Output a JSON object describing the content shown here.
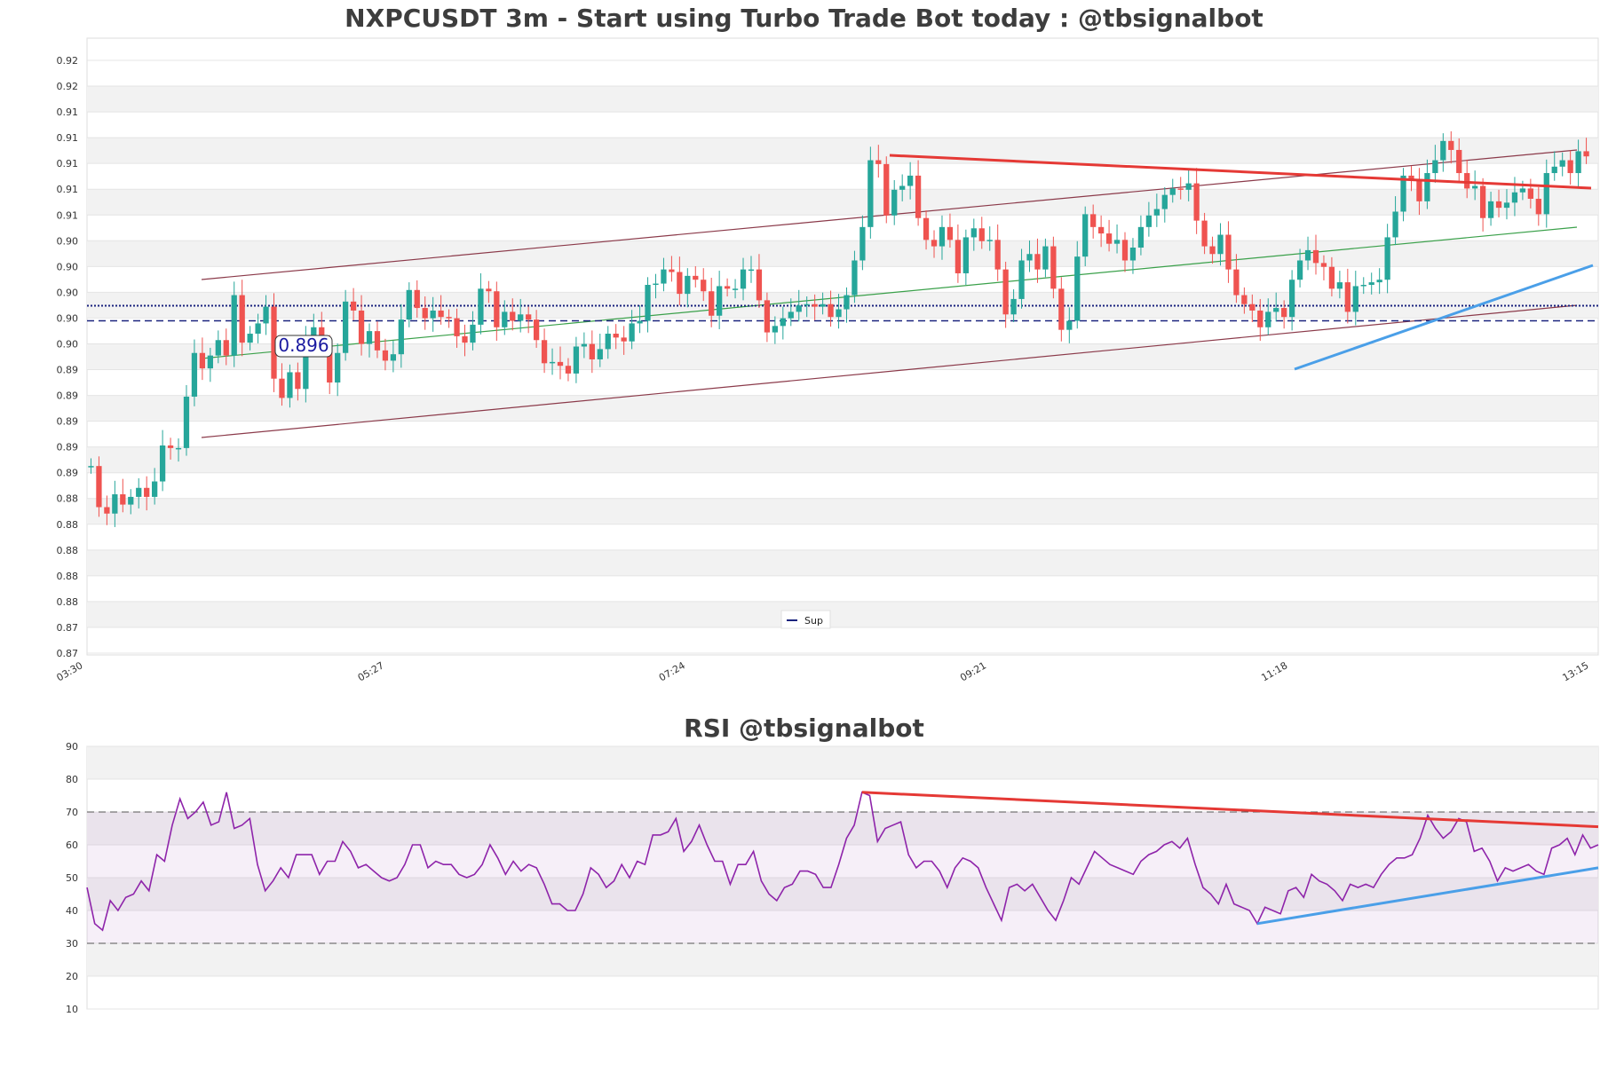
{
  "main_title": "NXPCUSDT 3m - Start using Turbo Trade Bot today : @tbsignalbot",
  "rsi_title": "RSI @tbsignalbot",
  "price_label": "0.896",
  "legend_label": "Sup",
  "colors": {
    "up": "#26a69a",
    "down": "#ef5350",
    "support": "#1a237e",
    "resistance_trend": "#e53935",
    "support_trend": "#4a9fe8",
    "channel": "#8b3a4a",
    "midline": "#3aa04a",
    "rsi_line": "#8e24aa"
  },
  "chart_data": [
    {
      "type": "candlestick",
      "title": "NXPCUSDT 3m - Start using Turbo Trade Bot today : @tbsignalbot",
      "x_tick_labels": [
        "03:30",
        "05:27",
        "07:24",
        "09:21",
        "11:18",
        "13:15"
      ],
      "y_tick_labels": [
        "0.92",
        "0.92",
        "0.91",
        "0.91",
        "0.91",
        "0.91",
        "0.91",
        "0.90",
        "0.90",
        "0.90",
        "0.90",
        "0.90",
        "0.89",
        "0.89",
        "0.89",
        "0.89",
        "0.89",
        "0.88",
        "0.88",
        "0.88",
        "0.88",
        "0.88",
        "0.87",
        "0.87"
      ],
      "ylim": [
        0.8715,
        0.9195
      ],
      "support_level": 0.8975,
      "support_label": "0.896",
      "legend": [
        "Sup"
      ],
      "legend_position": "bottom-center",
      "candles_start_close": 0.8862,
      "candle_closes": [
        0.8862,
        0.883,
        0.8825,
        0.884,
        0.8832,
        0.8838,
        0.8845,
        0.8838,
        0.885,
        0.8878,
        0.8876,
        0.8876,
        0.8916,
        0.895,
        0.8938,
        0.8948,
        0.896,
        0.8948,
        0.8995,
        0.8958,
        0.8965,
        0.8973,
        0.8986,
        0.893,
        0.8915,
        0.8935,
        0.8922,
        0.8962,
        0.897,
        0.8958,
        0.8927,
        0.895,
        0.899,
        0.8983,
        0.8957,
        0.8967,
        0.8952,
        0.8944,
        0.8949,
        0.8976,
        0.8999,
        0.8985,
        0.8977,
        0.8983,
        0.8978,
        0.8977,
        0.8963,
        0.8958,
        0.8972,
        0.9,
        0.8998,
        0.897,
        0.8982,
        0.8975,
        0.898,
        0.8976,
        0.896,
        0.8942,
        0.8943,
        0.894,
        0.8934,
        0.8955,
        0.8957,
        0.8945,
        0.8953,
        0.8965,
        0.8962,
        0.8959,
        0.8973,
        0.8975,
        0.9003,
        0.9004,
        0.9015,
        0.9013,
        0.8996,
        0.901,
        0.9007,
        0.8998,
        0.8979,
        0.9002,
        0.9,
        0.9,
        0.9015,
        0.9015,
        0.8991,
        0.8966,
        0.8971,
        0.8977,
        0.8982,
        0.8987,
        0.8988,
        0.8986,
        0.8988,
        0.8978,
        0.8984,
        0.8995,
        0.9022,
        0.9048,
        0.91,
        0.9097,
        0.9057,
        0.9077,
        0.908,
        0.9088,
        0.9055,
        0.9038,
        0.9033,
        0.9048,
        0.9038,
        0.9012,
        0.904,
        0.9047,
        0.9037,
        0.9038,
        0.9015,
        0.898,
        0.8992,
        0.9022,
        0.9027,
        0.9015,
        0.9033,
        0.9,
        0.8968,
        0.8975,
        0.9025,
        0.9058,
        0.9048,
        0.9043,
        0.9035,
        0.9038,
        0.9022,
        0.9032,
        0.9048,
        0.9057,
        0.9062,
        0.9073,
        0.9078,
        0.9077,
        0.9082,
        0.9053,
        0.9033,
        0.9027,
        0.9042,
        0.9015,
        0.8995,
        0.8988,
        0.8983,
        0.897,
        0.8982,
        0.8985,
        0.8978,
        0.9007,
        0.9022,
        0.903,
        0.902,
        0.9017,
        0.9,
        0.9005,
        0.8982,
        0.9002,
        0.9003,
        0.9005,
        0.9007,
        0.904,
        0.906,
        0.9088,
        0.9085,
        0.9068,
        0.909,
        0.91,
        0.9115,
        0.9108,
        0.909,
        0.9078,
        0.908,
        0.9055,
        0.9068,
        0.9063,
        0.9067,
        0.9075,
        0.9078,
        0.907,
        0.9058,
        0.909,
        0.9095,
        0.91,
        0.909,
        0.9107,
        0.9103
      ]
    },
    {
      "type": "line",
      "title": "RSI @tbsignalbot",
      "y_tick_labels": [
        "90",
        "80",
        "70",
        "60",
        "50",
        "40",
        "30",
        "20",
        "10"
      ],
      "ylim": [
        10,
        90
      ],
      "overbought": 70,
      "oversold": 30,
      "values": [
        47,
        36,
        34,
        43,
        40,
        44,
        45,
        49,
        46,
        57,
        55,
        66,
        74,
        68,
        70,
        73,
        66,
        67,
        76,
        65,
        66,
        68,
        54,
        46,
        49,
        53,
        50,
        57,
        57,
        57,
        51,
        55,
        55,
        61,
        58,
        53,
        54,
        52,
        50,
        49,
        50,
        54,
        60,
        60,
        53,
        55,
        54,
        54,
        51,
        50,
        51,
        54,
        60,
        56,
        51,
        55,
        52,
        54,
        53,
        48,
        42,
        42,
        40,
        40,
        45,
        53,
        51,
        47,
        49,
        54,
        50,
        55,
        54,
        63,
        63,
        64,
        68,
        58,
        61,
        66,
        60,
        55,
        55,
        48,
        54,
        54,
        58,
        49,
        45,
        43,
        47,
        48,
        52,
        52,
        51,
        47,
        47,
        54,
        62,
        66,
        76,
        75,
        61,
        65,
        66,
        67,
        57,
        53,
        55,
        55,
        52,
        47,
        53,
        56,
        55,
        53,
        47,
        42,
        37,
        47,
        48,
        46,
        48,
        44,
        40,
        37,
        43,
        50,
        48,
        53,
        58,
        56,
        54,
        53,
        52,
        51,
        55,
        57,
        58,
        60,
        61,
        59,
        62,
        54,
        47,
        45,
        42,
        48,
        42,
        41,
        40,
        36,
        41,
        40,
        39,
        46,
        47,
        44,
        51,
        49,
        48,
        46,
        43,
        48,
        47,
        48,
        47,
        51,
        54,
        56,
        56,
        57,
        62,
        69,
        65,
        62,
        64,
        68,
        67,
        58,
        59,
        55,
        49,
        53,
        52,
        53,
        54,
        52,
        51,
        59,
        60,
        62,
        57,
        63,
        59,
        60
      ]
    }
  ]
}
